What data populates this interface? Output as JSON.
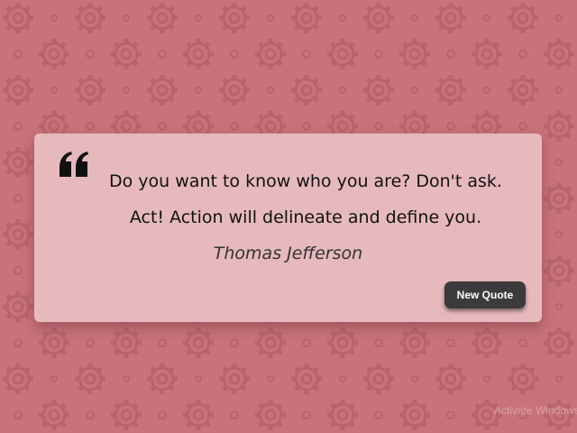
{
  "background": {
    "color": "#c8727a",
    "pattern_icon": "gear-icon"
  },
  "quote": {
    "icon": "quote-mark-icon",
    "text": "Do you want to know who you are? Don't ask. Act! Action will delineate and define you.",
    "author": "Thomas Jefferson"
  },
  "actions": {
    "new_quote_label": "New Quote"
  },
  "watermark": {
    "text": "Activate Windows"
  },
  "colors": {
    "card": "#e8bec2",
    "button": "#3b3b3b",
    "text": "#111111",
    "author": "#333333"
  }
}
